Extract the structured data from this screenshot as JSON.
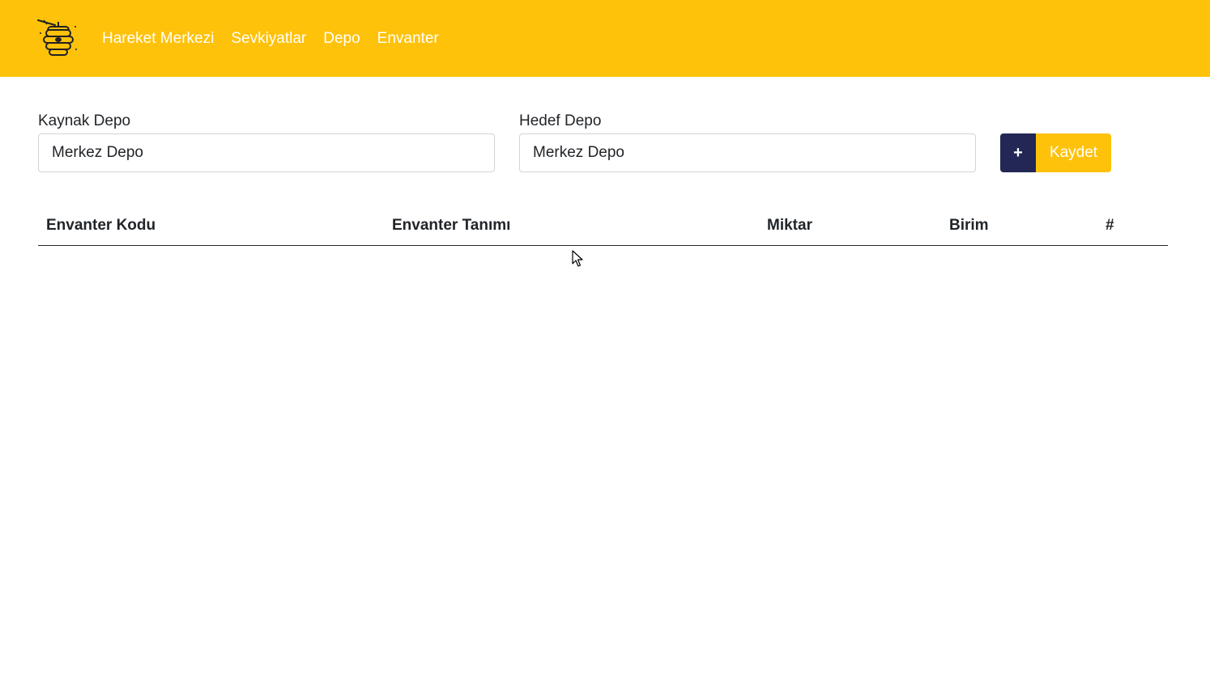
{
  "navbar": {
    "logo_icon": "beehive-icon",
    "bg_color": "#ffc20a",
    "links": [
      "Hareket Merkezi",
      "Sevkiyatlar",
      "Depo",
      "Envanter"
    ]
  },
  "form": {
    "source": {
      "label": "Kaynak Depo",
      "value": "Merkez Depo"
    },
    "target": {
      "label": "Hedef Depo",
      "value": "Merkez Depo"
    },
    "add_label": "+",
    "save_label": "Kaydet",
    "add_color": "#222755",
    "save_color": "#ffc20a"
  },
  "table": {
    "headers": [
      "Envanter Kodu",
      "Envanter Tanımı",
      "Miktar",
      "Birim",
      "#"
    ],
    "rows": []
  }
}
